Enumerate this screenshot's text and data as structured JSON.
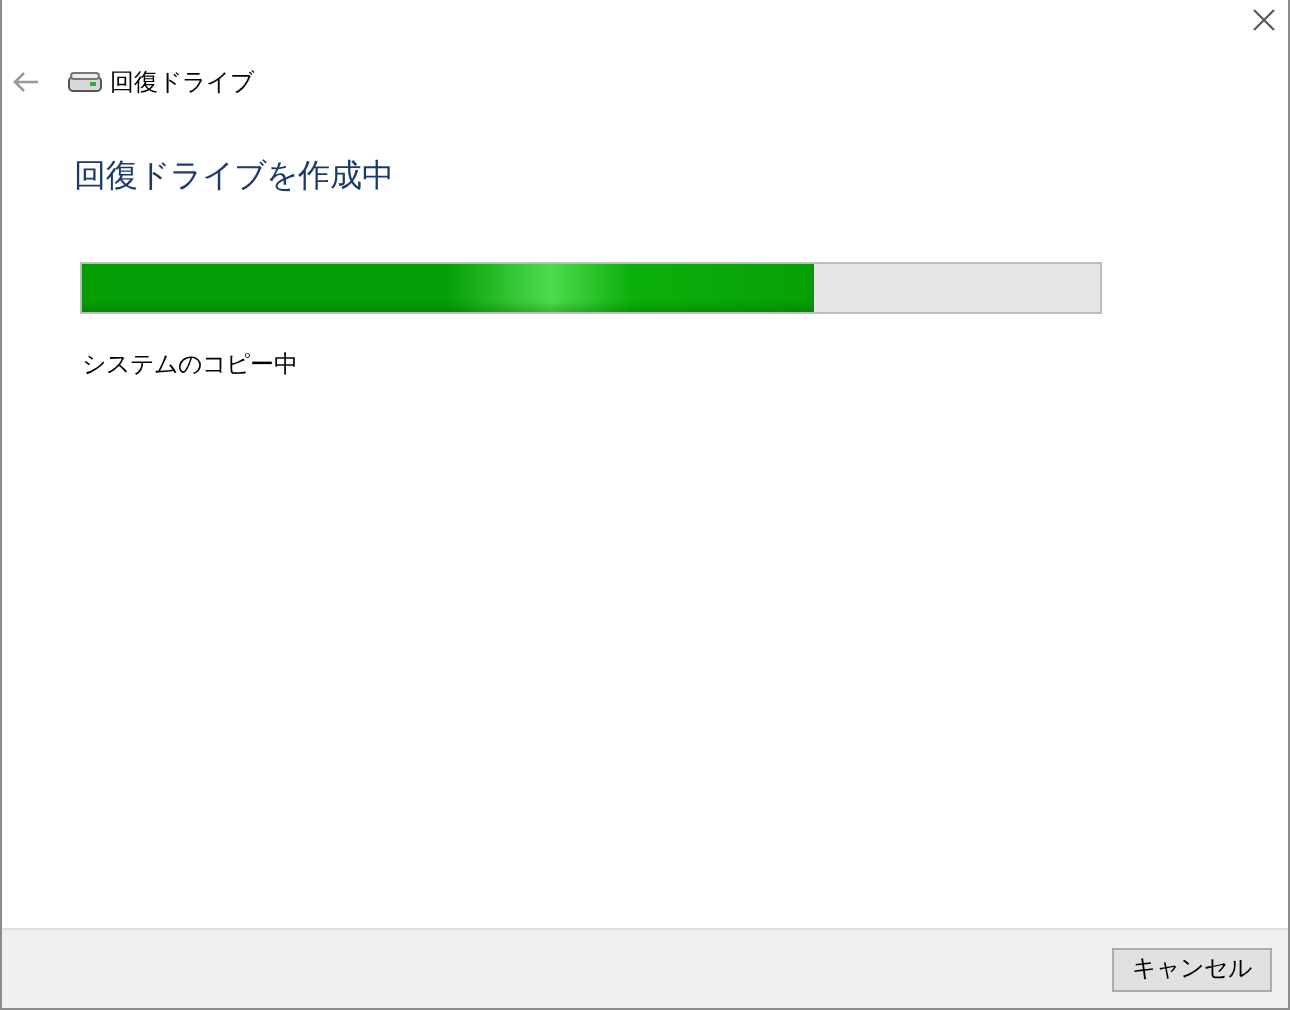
{
  "header": {
    "title": "回復ドライブ"
  },
  "heading": "回復ドライブを作成中",
  "progress": {
    "level": 0.72,
    "status": "システムのコピー中"
  },
  "buttons": [
    {
      "label": "キャンセル"
    }
  ]
}
